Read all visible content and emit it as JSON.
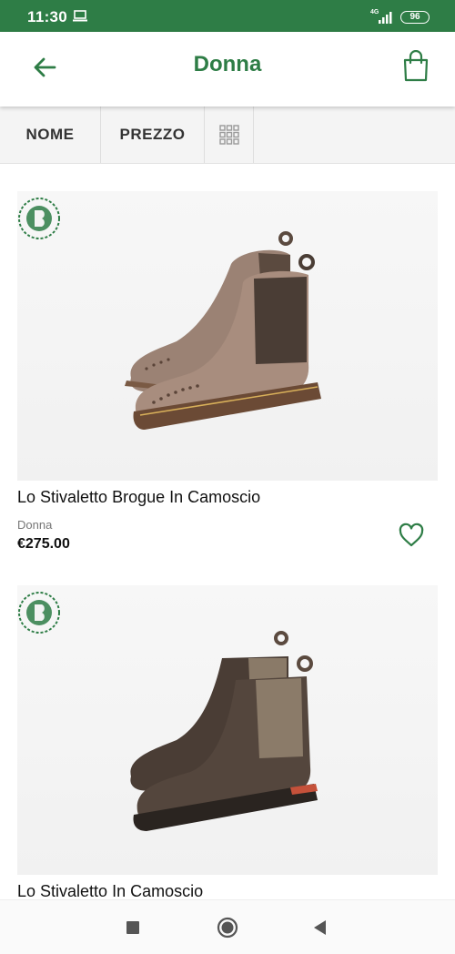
{
  "status_bar": {
    "time": "11:30",
    "network": "4G",
    "battery": "96"
  },
  "app_bar": {
    "title": "Donna",
    "back_icon": "arrow-left-icon",
    "cart_icon": "shopping-bag-icon"
  },
  "sort_bar": {
    "name_label": "NOME",
    "price_label": "PREZZO",
    "grid_icon": "grid-view-icon"
  },
  "products": [
    {
      "name": "Lo Stivaletto Brogue In Camoscio",
      "category": "Donna",
      "price": "€275.00",
      "favorite_icon": "heart-outline-icon"
    },
    {
      "name": "Lo Stivaletto In Camoscio"
    }
  ],
  "colors": {
    "brand_green": "#2e7d46",
    "boot_taupe": "#9b8274",
    "boot_brown": "#4a3d35"
  },
  "nav_bar": {
    "recents_icon": "square-icon",
    "home_icon": "circle-icon",
    "back_icon": "triangle-back-icon"
  }
}
